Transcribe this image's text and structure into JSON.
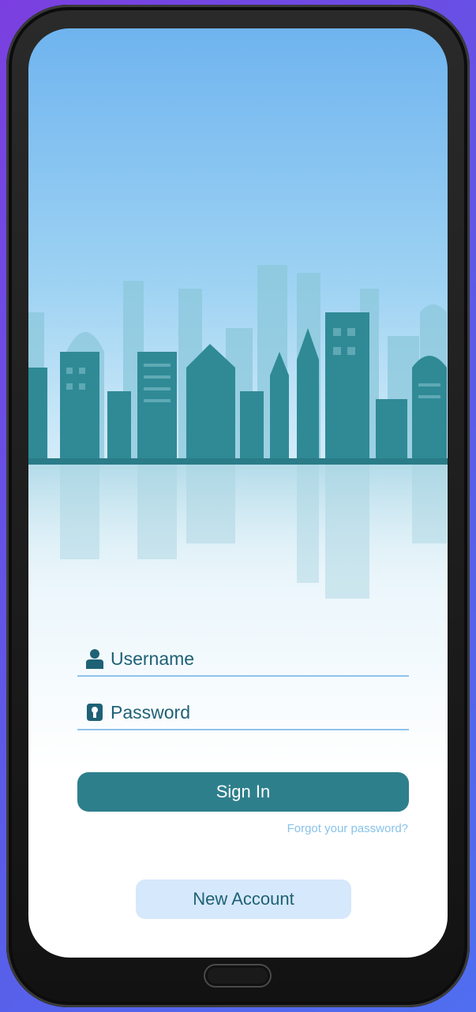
{
  "login": {
    "username_label": "Username",
    "password_label": "Password",
    "signin_label": "Sign In",
    "forgot_label": "Forgot your password?",
    "new_account_label": "New Account"
  },
  "icons": {
    "username": "user-icon",
    "password": "lock-icon"
  },
  "colors": {
    "primary": "#2e7f8c",
    "text": "#1e6175",
    "link": "#88c2ea",
    "secondary_button": "#d6e8fb",
    "field_line": "#8fc3ec"
  }
}
